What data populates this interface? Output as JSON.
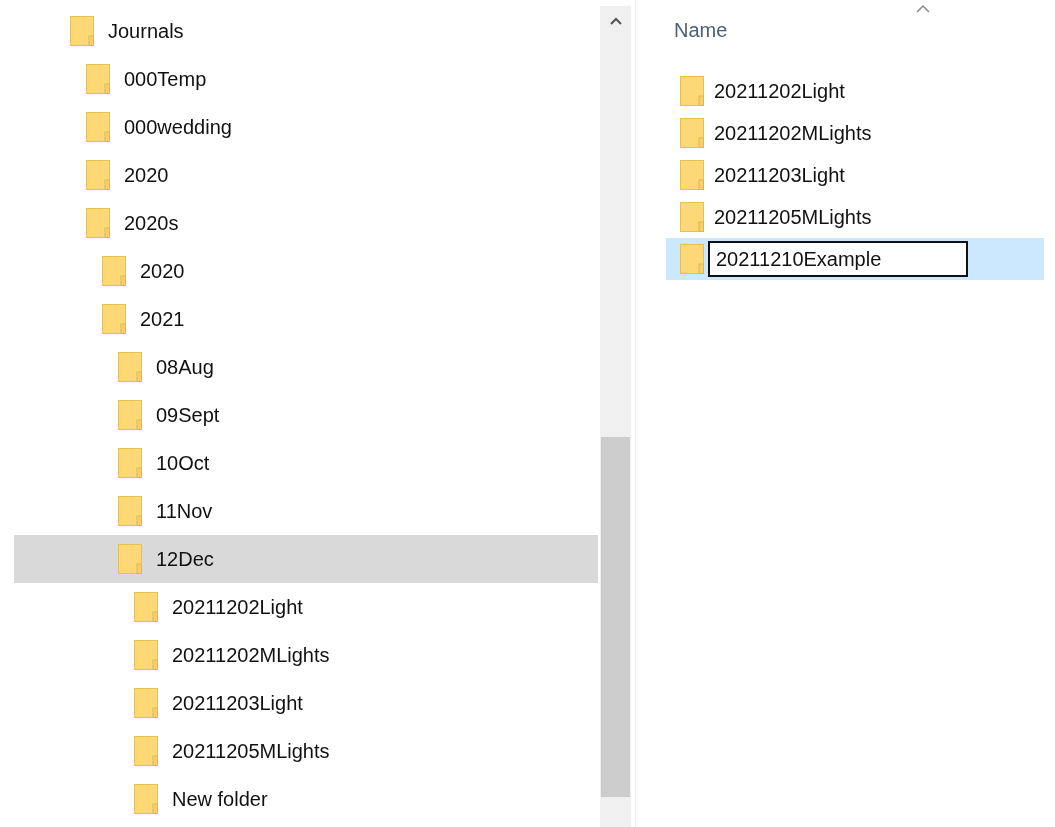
{
  "tree": [
    {
      "label": "Journals",
      "selected": false,
      "children": [
        {
          "label": "000Temp",
          "selected": false
        },
        {
          "label": "000wedding",
          "selected": false
        },
        {
          "label": "2020",
          "selected": false
        },
        {
          "label": "2020s",
          "selected": false,
          "children": [
            {
              "label": "2020",
              "selected": false
            },
            {
              "label": "2021",
              "selected": false,
              "children": [
                {
                  "label": "08Aug",
                  "selected": false
                },
                {
                  "label": "09Sept",
                  "selected": false
                },
                {
                  "label": "10Oct",
                  "selected": false
                },
                {
                  "label": "11Nov",
                  "selected": false
                },
                {
                  "label": "12Dec",
                  "selected": true,
                  "children": [
                    {
                      "label": "20211202Light",
                      "selected": false
                    },
                    {
                      "label": "20211202MLights",
                      "selected": false
                    },
                    {
                      "label": "20211203Light",
                      "selected": false
                    },
                    {
                      "label": "20211205MLights",
                      "selected": false
                    },
                    {
                      "label": "New folder",
                      "selected": false
                    }
                  ]
                }
              ]
            }
          ]
        }
      ]
    }
  ],
  "list": {
    "column": "Name",
    "files": [
      {
        "name": "20211202Light",
        "selected": false,
        "renaming": false
      },
      {
        "name": "20211202MLights",
        "selected": false,
        "renaming": false
      },
      {
        "name": "20211203Light",
        "selected": false,
        "renaming": false
      },
      {
        "name": "20211205MLights",
        "selected": false,
        "renaming": false
      },
      {
        "name": "20211210Example",
        "selected": true,
        "renaming": true
      }
    ]
  }
}
